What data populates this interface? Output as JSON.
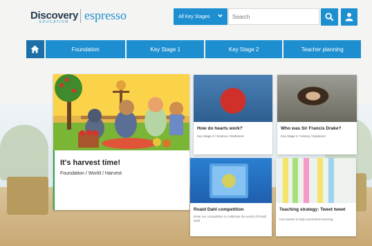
{
  "header": {
    "logo_main": "Discovery",
    "logo_sub": "EDUCATION",
    "logo_product": "espresso",
    "stage_select": "All Key Stages",
    "search_placeholder": "Search"
  },
  "nav": {
    "items": [
      {
        "label": "Foundation"
      },
      {
        "label": "Key Stage 1"
      },
      {
        "label": "Key Stage 2"
      },
      {
        "label": "Teacher planning"
      }
    ]
  },
  "hero": {
    "title": "It's harvest time!",
    "subtitle": "Foundation / World / Harvest"
  },
  "cards": [
    {
      "title": "How do hearts work?",
      "meta": "Key Stage 2 / Science / Endorsed"
    },
    {
      "title": "Who was Sir Francis Drake?",
      "meta": "Key Stage 2 / History / Explorers"
    },
    {
      "title": "Roald Dahl competition",
      "desc": "Enter our competition to celebrate the world of Roald Dahl"
    },
    {
      "title": "Teaching strategy: Tweet tweet",
      "desc": "Use tweets to help summarise learning"
    }
  ],
  "colors": {
    "brand_blue": "#1d8fd0",
    "nav_home": "#1d6fa8",
    "hero_accent": "#2aa84a"
  }
}
